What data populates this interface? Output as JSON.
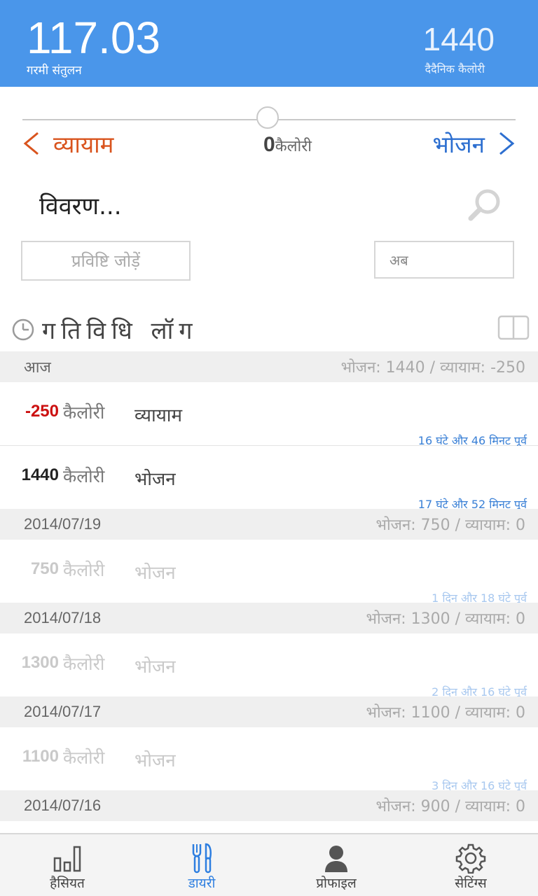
{
  "header": {
    "balance_value": "117.03",
    "balance_label": "गरमी संतुलन",
    "daily_value": "1440",
    "daily_label": "दैदैनिक कैलोरी"
  },
  "selector": {
    "left_label": "व्यायाम",
    "right_label": "भोजन",
    "calories_value": "0",
    "calories_unit": "कैलोरी"
  },
  "search": {
    "value": "विवरण...",
    "add_label": "प्रविष्टि जोड़ें",
    "time_value": "अब"
  },
  "log": {
    "title": "गतिविधि लॉग"
  },
  "days": [
    {
      "date": "आज",
      "summary": "भोजन: 1440 / व्यायाम: -250",
      "entries": [
        {
          "amount": "-250",
          "unit": "कैलोरी",
          "type": "व्यायाम",
          "time": "16 घंटे और 46 मिनट पूर्व"
        },
        {
          "amount": "1440",
          "unit": "कैलोरी",
          "type": "भोजन",
          "time": "17 घंटे और 52 मिनट पूर्व"
        }
      ]
    },
    {
      "date": "2014/07/19",
      "summary": "भोजन: 750 / व्यायाम: 0",
      "entries": [
        {
          "amount": "750",
          "unit": "कैलोरी",
          "type": "भोजन",
          "time": "1 दिन और 18 घंटे पूर्व"
        }
      ]
    },
    {
      "date": "2014/07/18",
      "summary": "भोजन: 1300 / व्यायाम: 0",
      "entries": [
        {
          "amount": "1300",
          "unit": "कैलोरी",
          "type": "भोजन",
          "time": "2 दिन और 16 घंटे पूर्व"
        }
      ]
    },
    {
      "date": "2014/07/17",
      "summary": "भोजन: 1100 / व्यायाम: 0",
      "entries": [
        {
          "amount": "1100",
          "unit": "कैलोरी",
          "type": "भोजन",
          "time": "3 दिन और 16 घंटे पूर्व"
        }
      ]
    },
    {
      "date": "2014/07/16",
      "summary": "भोजन: 900 / व्यायाम: 0",
      "entries": []
    }
  ],
  "tabs": [
    {
      "label": "हैसियत",
      "icon": "bar-chart-icon"
    },
    {
      "label": "डायरी",
      "icon": "fork-knife-icon"
    },
    {
      "label": "प्रोफाइल",
      "icon": "person-icon"
    },
    {
      "label": "सेटिंग्स",
      "icon": "gear-icon"
    }
  ],
  "colors": {
    "header_bg": "#4a96ea",
    "exercise": "#d9541e",
    "food": "#2d6fd0",
    "negative": "#cc1111",
    "active_tab": "#2d7ee0"
  }
}
